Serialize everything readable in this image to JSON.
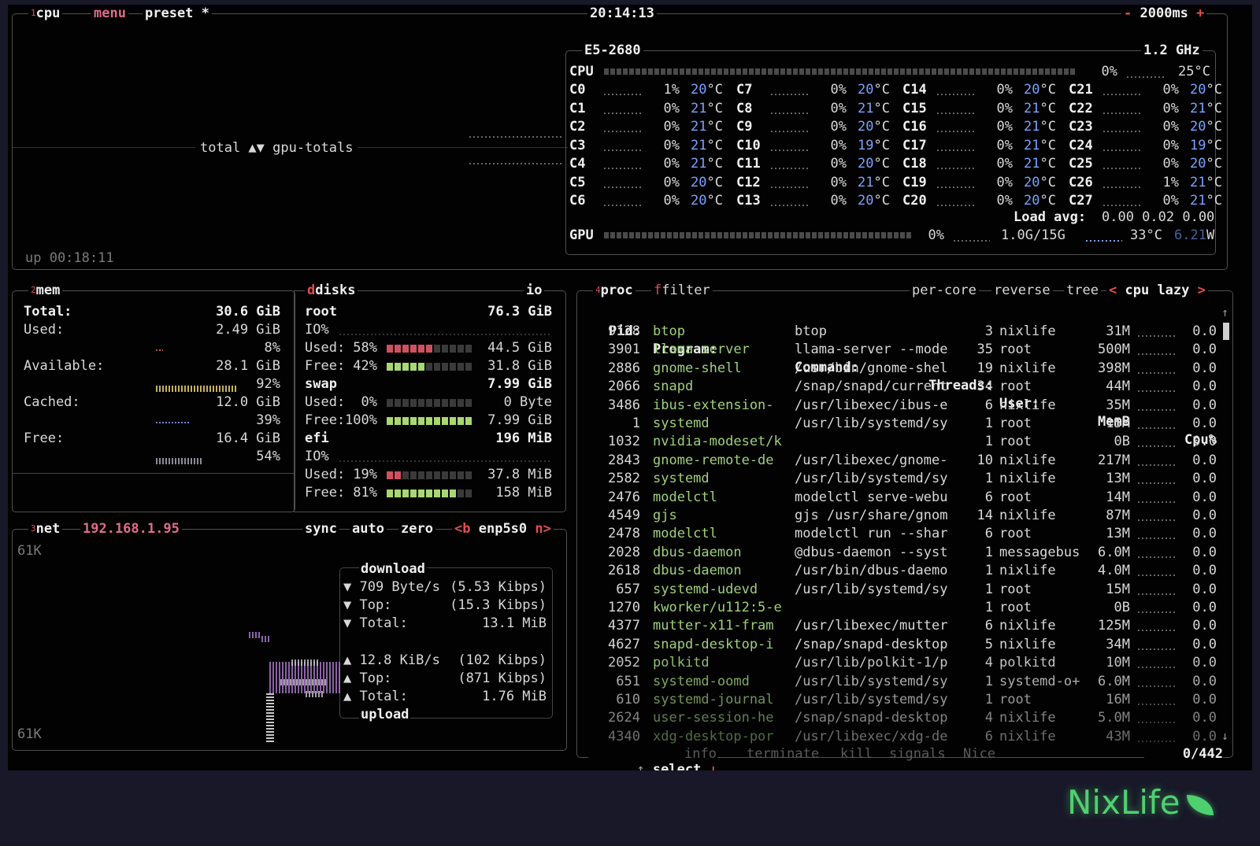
{
  "cpu_box": {
    "num": "1",
    "label": "cpu",
    "menu": "menu",
    "preset": "preset *",
    "clock": "20:14:13",
    "minus": "-",
    "interval": "2000ms",
    "plus": "+",
    "graph_label": "total ▲▼ gpu-totals",
    "uptime": "up 00:18:11"
  },
  "cpu_info": {
    "model": "E5-2680",
    "freq": "1.2 GHz",
    "cpu_label": "CPU",
    "cpu_pct": "0%",
    "cpu_temp": "25°C",
    "cores": [
      [
        "C0",
        "1%",
        "20"
      ],
      [
        "C1",
        "0%",
        "21"
      ],
      [
        "C2",
        "0%",
        "21"
      ],
      [
        "C3",
        "0%",
        "21"
      ],
      [
        "C4",
        "0%",
        "21"
      ],
      [
        "C5",
        "0%",
        "20"
      ],
      [
        "C6",
        "0%",
        "20"
      ],
      [
        "C7",
        "0%",
        "20"
      ],
      [
        "C8",
        "0%",
        "21"
      ],
      [
        "C9",
        "0%",
        "20"
      ],
      [
        "C10",
        "0%",
        "19"
      ],
      [
        "C11",
        "0%",
        "20"
      ],
      [
        "C12",
        "0%",
        "21"
      ],
      [
        "C13",
        "0%",
        "20"
      ],
      [
        "C14",
        "0%",
        "20"
      ],
      [
        "C15",
        "0%",
        "21"
      ],
      [
        "C16",
        "0%",
        "21"
      ],
      [
        "C17",
        "0%",
        "21"
      ],
      [
        "C18",
        "0%",
        "21"
      ],
      [
        "C19",
        "0%",
        "20"
      ],
      [
        "C20",
        "0%",
        "20"
      ],
      [
        "C21",
        "0%",
        "20"
      ],
      [
        "C22",
        "0%",
        "21"
      ],
      [
        "C23",
        "0%",
        "20"
      ],
      [
        "C24",
        "0%",
        "19"
      ],
      [
        "C25",
        "0%",
        "20"
      ],
      [
        "C26",
        "1%",
        "21"
      ],
      [
        "C27",
        "0%",
        "21"
      ]
    ],
    "deg": "°C",
    "load_label": "Load avg:",
    "load_values": "0.00 0.02 0.00",
    "gpu_label": "GPU",
    "gpu_pct": "0%",
    "gpu_mem": "1.0G/15G",
    "gpu_temp": "33°C",
    "gpu_power": "6.21",
    "gpu_power_unit": "W"
  },
  "mem": {
    "num": "2",
    "label": "mem",
    "rows": [
      {
        "k": "Total:",
        "v": "30.6 GiB"
      },
      {
        "k": "Used:",
        "v": "2.49 GiB",
        "pct": "8%"
      },
      {
        "k": "Available:",
        "v": "28.1 GiB",
        "pct": "92%"
      },
      {
        "k": "Cached:",
        "v": "12.0 GiB",
        "pct": "39%"
      },
      {
        "k": "Free:",
        "v": "16.4 GiB",
        "pct": "54%"
      }
    ]
  },
  "disks": {
    "label": "disks",
    "io": "io",
    "root": {
      "name": "root",
      "size": "76.3 GiB",
      "io": "IO%",
      "used_l": "Used:",
      "used_p": "58%",
      "used_v": "44.5 GiB",
      "free_l": "Free:",
      "free_p": "42%",
      "free_v": "31.8 GiB"
    },
    "swap": {
      "name": "swap",
      "size": "7.99 GiB",
      "used_l": "Used:",
      "used_p": "0%",
      "used_v": "0 Byte",
      "free_l": "Free:",
      "free_p": "100%",
      "free_v": "7.99 GiB"
    },
    "efi": {
      "name": "efi",
      "size": "196 MiB",
      "io": "IO%",
      "used_l": "Used:",
      "used_p": "19%",
      "used_v": "37.8 MiB",
      "free_l": "Free:",
      "free_p": "81%",
      "free_v": "158 MiB"
    },
    "levels": {
      "root_used": 0.58,
      "root_free": 0.42,
      "swap_used": 0,
      "swap_free": 1.0,
      "efi_used": 0.19,
      "efi_free": 0.81
    }
  },
  "net": {
    "num": "3",
    "label": "net",
    "ip": "192.168.1.95",
    "sync": "sync",
    "auto": "auto",
    "zero": "zero",
    "prev": "<b",
    "iface": "enp5s0",
    "next": "n>",
    "scale_top": "61K",
    "scale_bot": "61K",
    "download": "download",
    "dl_rate": "▼ 709 Byte/s",
    "dl_rate_k": "(5.53 Kibps)",
    "dl_top": "▼ Top:",
    "dl_top_v": "(15.3 Kibps)",
    "dl_total": "▼ Total:",
    "dl_total_v": "13.1 MiB",
    "ul_rate": "▲ 12.8 KiB/s",
    "ul_rate_k": "(102 Kibps)",
    "ul_top": "▲ Top:",
    "ul_top_v": "(871 Kibps)",
    "ul_total": "▲ Total:",
    "ul_total_v": "1.76 MiB",
    "upload": "upload"
  },
  "proc": {
    "num": "4",
    "label": "proc",
    "filter": "filter",
    "per_core": "per-core",
    "reverse": "reverse",
    "tree": "tree",
    "sort_prev": "<",
    "sort": "cpu lazy",
    "sort_next": ">",
    "headers": {
      "pid": "Pid:",
      "program": "Program:",
      "command": "Command:",
      "threads": "Threads:",
      "user": "User:",
      "memb": "MemB",
      "cpu": "Cpu%"
    },
    "rows": [
      [
        "9128",
        "btop",
        "btop",
        "3",
        "nixlife",
        "31M",
        "0.0"
      ],
      [
        "3901",
        "llama-server",
        "llama-server --mode",
        "35",
        "root",
        "500M",
        "0.0"
      ],
      [
        "2886",
        "gnome-shell",
        "/usr/bin/gnome-shel",
        "19",
        "nixlife",
        "398M",
        "0.0"
      ],
      [
        "2066",
        "snapd",
        "/snap/snapd/current",
        "34",
        "root",
        "44M",
        "0.0"
      ],
      [
        "3486",
        "ibus-extension-",
        "/usr/libexec/ibus-e",
        "6",
        "nixlife",
        "35M",
        "0.0"
      ],
      [
        "1",
        "systemd",
        "/usr/lib/systemd/sy",
        "1",
        "root",
        "15M",
        "0.0"
      ],
      [
        "1032",
        "nvidia-modeset/k",
        "",
        "1",
        "root",
        "0B",
        "0.0"
      ],
      [
        "2843",
        "gnome-remote-de",
        "/usr/libexec/gnome-",
        "10",
        "nixlife",
        "217M",
        "0.0"
      ],
      [
        "2582",
        "systemd",
        "/usr/lib/systemd/sy",
        "1",
        "nixlife",
        "13M",
        "0.0"
      ],
      [
        "2476",
        "modelctl",
        "modelctl serve-webu",
        "6",
        "root",
        "14M",
        "0.0"
      ],
      [
        "4549",
        "gjs",
        "gjs /usr/share/gnom",
        "14",
        "nixlife",
        "87M",
        "0.0"
      ],
      [
        "2478",
        "modelctl",
        "modelctl run --shar",
        "6",
        "root",
        "13M",
        "0.0"
      ],
      [
        "2028",
        "dbus-daemon",
        "@dbus-daemon --syst",
        "1",
        "messagebus",
        "6.0M",
        "0.0"
      ],
      [
        "2618",
        "dbus-daemon",
        "/usr/bin/dbus-daemo",
        "1",
        "nixlife",
        "4.0M",
        "0.0"
      ],
      [
        "657",
        "systemd-udevd",
        "/usr/lib/systemd/sy",
        "1",
        "root",
        "15M",
        "0.0"
      ],
      [
        "1270",
        "kworker/u112:5-e",
        "",
        "1",
        "root",
        "0B",
        "0.0"
      ],
      [
        "4377",
        "mutter-x11-fram",
        "/usr/libexec/mutter",
        "6",
        "nixlife",
        "125M",
        "0.0"
      ],
      [
        "4627",
        "snapd-desktop-i",
        "/snap/snapd-desktop",
        "5",
        "nixlife",
        "34M",
        "0.0"
      ],
      [
        "2052",
        "polkitd",
        "/usr/lib/polkit-1/p",
        "4",
        "polkitd",
        "10M",
        "0.0"
      ],
      [
        "651",
        "systemd-oomd",
        "/usr/lib/systemd/sy",
        "1",
        "systemd-o+",
        "6.0M",
        "0.0"
      ],
      [
        "610",
        "systemd-journal",
        "/usr/lib/systemd/sy",
        "1",
        "root",
        "16M",
        "0.0"
      ],
      [
        "2624",
        "user-session-he",
        "/snap/snapd-desktop",
        "4",
        "nixlife",
        "5.0M",
        "0.0"
      ],
      [
        "4340",
        "xdg-desktop-por",
        "/usr/libexec/xdg-de",
        "6",
        "nixlife",
        "43M",
        "0.0"
      ]
    ],
    "footer": {
      "select": "select",
      "info": "info",
      "terminate": "terminate",
      "kill": "kill",
      "signals": "signals",
      "nice": "Nice",
      "count": "0/442"
    }
  },
  "logo": {
    "text": "NixLife"
  },
  "colors": {
    "accent": "#e06c8a",
    "hot": "#e05050",
    "temp": "#7aa2ff",
    "prog": "#9fd07a",
    "logo": "#4fd070"
  }
}
